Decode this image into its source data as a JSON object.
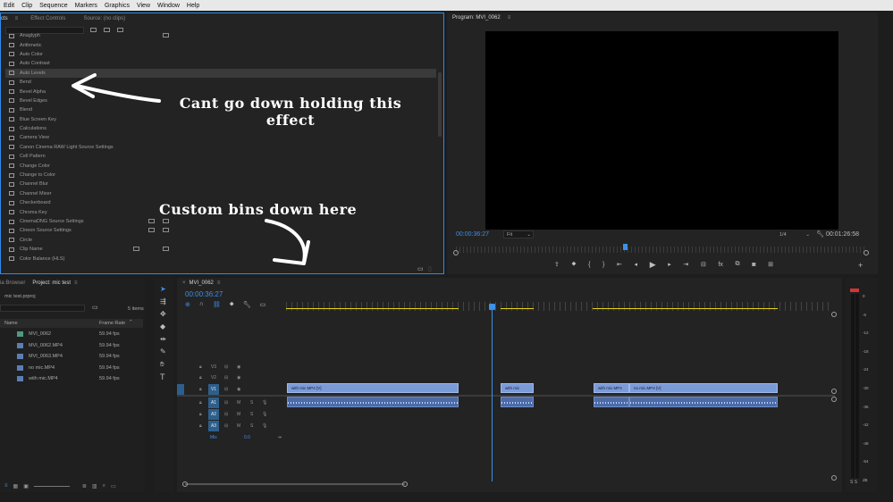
{
  "menu": [
    "Edit",
    "Clip",
    "Sequence",
    "Markers",
    "Graphics",
    "View",
    "Window",
    "Help"
  ],
  "effects_panel": {
    "tabs": [
      "cts",
      "Effect Controls",
      "Source: (no clips)"
    ],
    "items": [
      "Anaglyph",
      "Arithmetic",
      "Auto Color",
      "Auto Contrast",
      "Auto Levels",
      "Bend",
      "Bevel Alpha",
      "Bevel Edges",
      "Blend",
      "Blue Screen Key",
      "Calculations",
      "Camera View",
      "Canon Cinema RAW Light Source Settings",
      "Cell Pattern",
      "Change Color",
      "Change to Color",
      "Channel Blur",
      "Channel Mixer",
      "Checkerboard",
      "Chroma Key",
      "CinemaDNG Source Settings",
      "Cineon Source Settings",
      "Circle",
      "Clip Name",
      "Color Balance (HLS)"
    ],
    "selected_index": 4
  },
  "monitor": {
    "title": "Program: MVI_0062",
    "timecode": "00:00:36:27",
    "fit": "Fit",
    "resolution": "1/4",
    "duration": "00:01:26:58"
  },
  "project_panel": {
    "tabs": [
      "ia Browser",
      "Project: mic test"
    ],
    "file": "mic test.prproj",
    "count": "5 items",
    "col_name": "Name",
    "col_rate": "Frame Rate",
    "items": [
      {
        "name": "MVI_0062",
        "rate": "59.94 fps"
      },
      {
        "name": "MVI_0062.MP4",
        "rate": "59.94 fps"
      },
      {
        "name": "MVI_0063.MP4",
        "rate": "59.94 fps"
      },
      {
        "name": "no mic.MP4",
        "rate": "59.94 fps"
      },
      {
        "name": "with mic.MP4",
        "rate": "59.94 fps"
      }
    ]
  },
  "timeline": {
    "tab": "MVI_0062",
    "timecode": "00:00:36:27",
    "video_tracks": [
      "V3",
      "V2",
      "V1"
    ],
    "audio_tracks": [
      "A1",
      "A2",
      "A3"
    ],
    "mix_label": "Mix",
    "mix_value": "0.0",
    "clips": [
      "with mic.MP4 [V]",
      "with mic",
      "with mic.MP4",
      "no mic.MP4 [V]"
    ]
  },
  "meter": {
    "labels": [
      "0",
      "-6",
      "-12",
      "-18",
      "-24",
      "-30",
      "-36",
      "-42",
      "-48",
      "-54",
      "dB"
    ],
    "solo": "S S"
  },
  "annotations": {
    "arrow_note": "Cant go down holding this effect",
    "bins_note": "Custom bins down here"
  },
  "colors": {
    "accent_blue": "#2d8ceb",
    "clip_blue": "#7b9bd8",
    "work_area": "#e6d419"
  }
}
